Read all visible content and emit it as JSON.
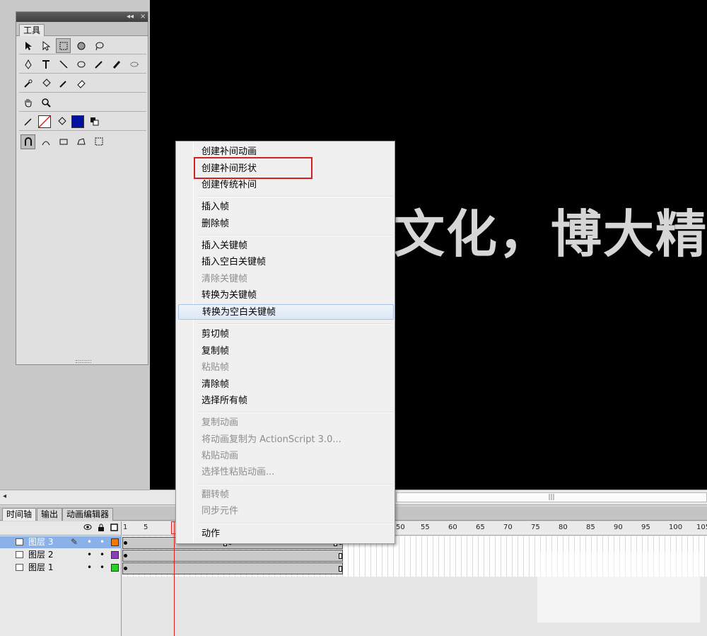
{
  "stage": {
    "text": "文化，博大精深"
  },
  "tools_panel": {
    "tab_label": "工具",
    "collapse_glyph": "◂◂",
    "close_glyph": "×"
  },
  "scrollbar": {
    "left_arrow": "◂",
    "thumb_grip": "|||"
  },
  "timeline": {
    "tabs": [
      "时间轴",
      "输出",
      "动画编辑器"
    ],
    "header_icons": [
      "eye-icon",
      "lock-icon",
      "outline-icon"
    ],
    "ruler_numbers": [
      "1",
      "5",
      "50",
      "55",
      "60",
      "65",
      "70",
      "75",
      "80",
      "85",
      "90",
      "95",
      "100",
      "105"
    ],
    "layers": [
      {
        "name": "图层 3",
        "color": "#f07a00",
        "selected": true
      },
      {
        "name": "图层 2",
        "color": "#8a3fb3",
        "selected": false
      },
      {
        "name": "图层 1",
        "color": "#28d028",
        "selected": false
      }
    ],
    "dot": "•",
    "pencil": "✎"
  },
  "context_menu": {
    "items": [
      {
        "label": "创建补间动画",
        "disabled": false
      },
      {
        "label": "创建补间形状",
        "disabled": false
      },
      {
        "label": "创建传统补间",
        "disabled": false
      },
      {
        "label": "插入帧",
        "disabled": false
      },
      {
        "label": "删除帧",
        "disabled": false
      },
      {
        "label": "插入关键帧",
        "disabled": false
      },
      {
        "label": "插入空白关键帧",
        "disabled": false
      },
      {
        "label": "清除关键帧",
        "disabled": true
      },
      {
        "label": "转换为关键帧",
        "disabled": false
      },
      {
        "label": "转换为空白关键帧",
        "disabled": false,
        "hovered": true
      },
      {
        "label": "剪切帧",
        "disabled": false
      },
      {
        "label": "复制帧",
        "disabled": false
      },
      {
        "label": "粘贴帧",
        "disabled": true
      },
      {
        "label": "清除帧",
        "disabled": false
      },
      {
        "label": "选择所有帧",
        "disabled": false
      },
      {
        "label": "复制动画",
        "disabled": true
      },
      {
        "label": "将动画复制为 ActionScript 3.0...",
        "disabled": true
      },
      {
        "label": "粘贴动画",
        "disabled": true
      },
      {
        "label": "选择性粘贴动画...",
        "disabled": true
      },
      {
        "label": "翻转帧",
        "disabled": true
      },
      {
        "label": "同步元件",
        "disabled": true
      },
      {
        "label": "动作",
        "disabled": false
      }
    ],
    "highlighted_item": "创建补间形状"
  },
  "colors": {
    "stage_bg": "#000000",
    "highlight": "#d42020",
    "fill_color": "#0010a0",
    "selected_layer": "#8ab2e8"
  }
}
